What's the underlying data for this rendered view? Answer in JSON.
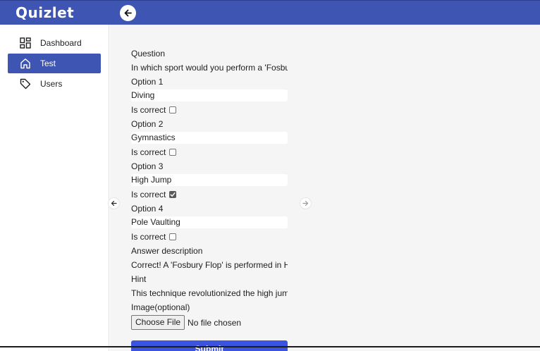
{
  "app": {
    "title": "Quizlet"
  },
  "sidebar": {
    "items": [
      {
        "label": "Dashboard",
        "icon": "grid-icon",
        "active": false
      },
      {
        "label": "Test",
        "icon": "home-icon",
        "active": true
      },
      {
        "label": "Users",
        "icon": "tag-icon",
        "active": false
      }
    ]
  },
  "form": {
    "question_label": "Question",
    "question_value": "In which sport would you perform a 'Fosbury Flop'?",
    "options": [
      {
        "label": "Option 1",
        "value": "Diving",
        "correct_label": "Is correct",
        "correct": false
      },
      {
        "label": "Option 2",
        "value": "Gymnastics",
        "correct_label": "Is correct",
        "correct": false
      },
      {
        "label": "Option 3",
        "value": "High Jump",
        "correct_label": "Is correct",
        "correct": true
      },
      {
        "label": "Option 4",
        "value": "Pole Vaulting",
        "correct_label": "Is correct",
        "correct": false
      }
    ],
    "answer_description_label": "Answer description",
    "answer_description_value": "Correct! A 'Fosbury Flop' is performed in High Jump.",
    "hint_label": "Hint",
    "hint_value": "This technique revolutionized the high jump event.",
    "image_label": "Image(optional)",
    "file_button_label": "Choose File",
    "file_status": "No file chosen",
    "submit_label": "Submit"
  },
  "colors": {
    "brand": "#3e55b3",
    "submit": "#3b54e0",
    "background": "#f5f5f5"
  }
}
